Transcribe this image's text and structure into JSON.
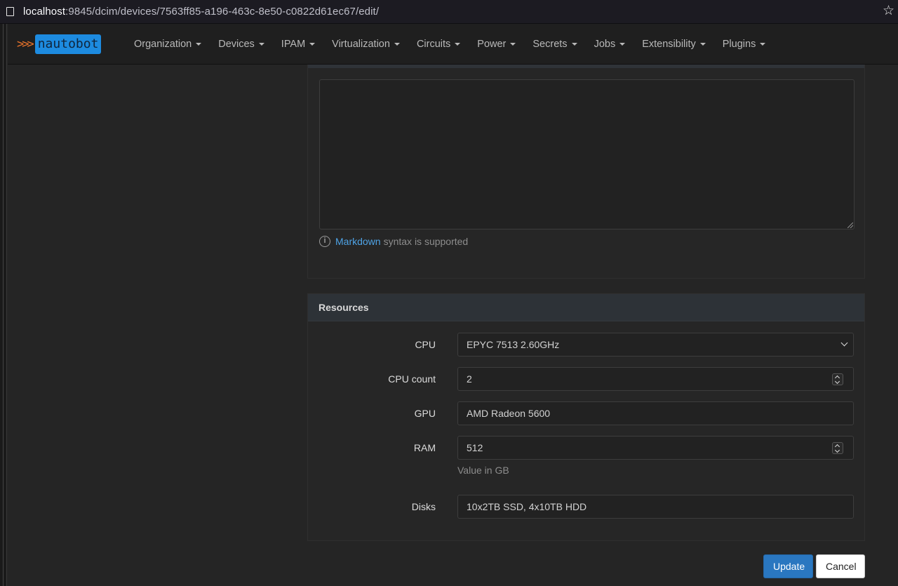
{
  "browser": {
    "url_host": "localhost",
    "url_rest": ":9845/dcim/devices/7563ff85-a196-463c-8e50-c0822d61ec67/edit/"
  },
  "navbar": {
    "brand_chevrons": ">>>",
    "brand_text": "nautobot",
    "items": [
      {
        "label": "Organization"
      },
      {
        "label": "Devices"
      },
      {
        "label": "IPAM"
      },
      {
        "label": "Virtualization"
      },
      {
        "label": "Circuits"
      },
      {
        "label": "Power"
      },
      {
        "label": "Secrets"
      },
      {
        "label": "Jobs"
      },
      {
        "label": "Extensibility"
      },
      {
        "label": "Plugins"
      }
    ]
  },
  "comments": {
    "textarea_value": "",
    "help_link": "Markdown",
    "help_text": "syntax is supported"
  },
  "resources": {
    "heading": "Resources",
    "cpu": {
      "label": "CPU",
      "value": "EPYC 7513 2.60GHz"
    },
    "cpu_count": {
      "label": "CPU count",
      "value": "2"
    },
    "gpu": {
      "label": "GPU",
      "value": "AMD Radeon 5600"
    },
    "ram": {
      "label": "RAM",
      "value": "512",
      "hint": "Value in GB"
    },
    "disks": {
      "label": "Disks",
      "value": "10x2TB SSD, 4x10TB HDD"
    }
  },
  "actions": {
    "update_label": "Update",
    "cancel_label": "Cancel"
  },
  "colors": {
    "accent": "#2a77c0",
    "link": "#4ea3e6",
    "brand_logo": "#1d8be0",
    "brand_chevrons": "#e8732b"
  }
}
